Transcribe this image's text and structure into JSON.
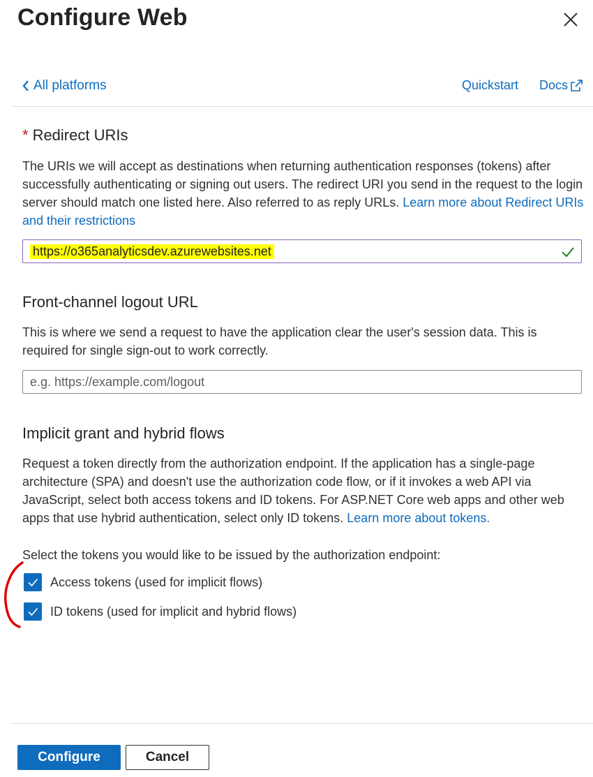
{
  "panel": {
    "title": "Configure Web"
  },
  "nav": {
    "back_label": "All platforms",
    "quickstart_label": "Quickstart",
    "docs_label": "Docs"
  },
  "redirect": {
    "title": "Redirect URIs",
    "required_marker": "*",
    "description": "The URIs we will accept as destinations when returning authentication responses (tokens) after successfully authenticating or signing out users. The redirect URI you send in the request to the login server should match one listed here. Also referred to as reply URLs. ",
    "learn_more": "Learn more about Redirect URIs and their restrictions",
    "value": "https://o365analyticsdev.azurewebsites.net"
  },
  "logout": {
    "title": "Front-channel logout URL",
    "description": "This is where we send a request to have the application clear the user's session data. This is required for single sign-out to work correctly.",
    "placeholder": "e.g. https://example.com/logout"
  },
  "implicit": {
    "title": "Implicit grant and hybrid flows",
    "description": "Request a token directly from the authorization endpoint. If the application has a single-page architecture (SPA) and doesn't use the authorization code flow, or if it invokes a web API via JavaScript, select both access tokens and ID tokens. For ASP.NET Core web apps and other web apps that use hybrid authentication, select only ID tokens. ",
    "learn_more": "Learn more about tokens.",
    "select_prompt": "Select the tokens you would like to be issued by the authorization endpoint:",
    "access_tokens_label": "Access tokens (used for implicit flows)",
    "id_tokens_label": "ID tokens (used for implicit and hybrid flows)",
    "access_tokens_checked": true,
    "id_tokens_checked": true
  },
  "footer": {
    "configure_label": "Configure",
    "cancel_label": "Cancel"
  },
  "colors": {
    "accent": "#0f6cbd",
    "highlight": "#ffff00",
    "annotation": "#e00000",
    "valid_check": "#107c10"
  }
}
